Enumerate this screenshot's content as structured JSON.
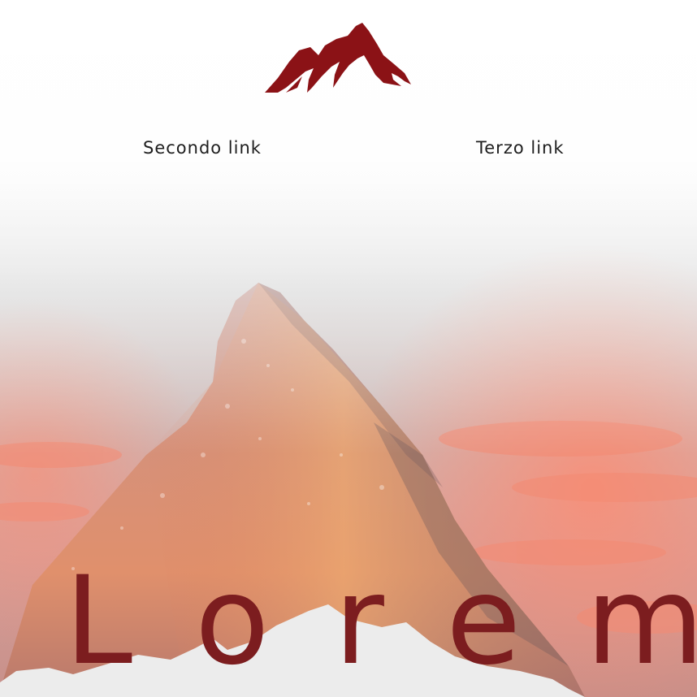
{
  "header": {
    "logo_icon": "mountain-logo-icon",
    "brand_color": "#8b1216"
  },
  "nav": {
    "items": [
      {
        "label": "Secondo link"
      },
      {
        "label": "Terzo link"
      }
    ]
  },
  "hero": {
    "title": "Lorem",
    "title_color": "#7c1d1f",
    "sky_glow_color": "#f2836f",
    "snow_color": "#ececec"
  }
}
